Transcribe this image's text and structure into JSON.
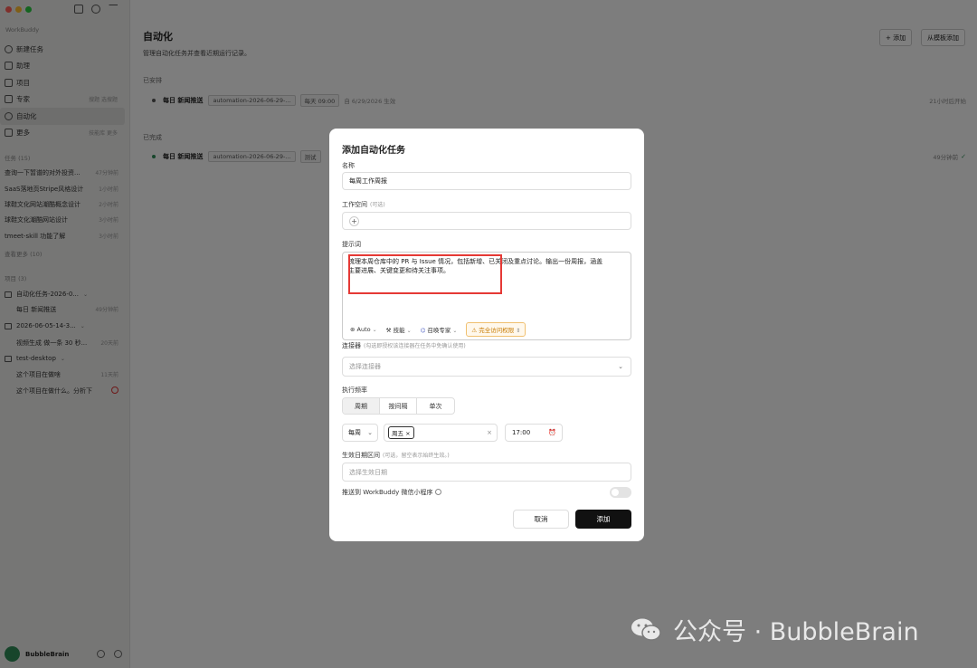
{
  "sidebar": {
    "workspace": "WorkBuddy",
    "nav": [
      {
        "label": "新建任务",
        "sub": ""
      },
      {
        "label": "助理",
        "sub": ""
      },
      {
        "label": "项目",
        "sub": ""
      },
      {
        "label": "专家",
        "sub": "搜题 选搜题"
      },
      {
        "label": "自动化",
        "sub": ""
      },
      {
        "label": "更多",
        "sub": "技能库 更多"
      }
    ],
    "tasks_title": "任务 (15)",
    "tasks": [
      {
        "label": "查询一下暂谱的对外投资...",
        "time": "47分钟前"
      },
      {
        "label": "SaaS落地页Stripe风格设计",
        "time": "1小时前"
      },
      {
        "label": "球鞋文化网站潮酷概念设计",
        "time": "2小时前"
      },
      {
        "label": "球鞋文化潮酷网站设计",
        "time": "3小时前"
      },
      {
        "label": "tmeet-skill 功能了解",
        "time": "3小时前"
      }
    ],
    "show_more": "查看更多 (10)",
    "projects_title": "项目 (3)",
    "projects": [
      {
        "label": "自动化任务-2026-0...",
        "children": [
          {
            "label": "每日 新闻推送",
            "time": "49分钟前"
          }
        ]
      },
      {
        "label": "2026-06-05-14-3...",
        "children": [
          {
            "label": "视频生成 做一条 30 秒...",
            "time": "20天前"
          }
        ]
      },
      {
        "label": "test-desktop",
        "children": [
          {
            "label": "这个项目在做啥",
            "time": "11天前"
          },
          {
            "label": "这个项目在做什么。分析下",
            "time": ""
          }
        ]
      }
    ],
    "user_name": "BubbleBrain"
  },
  "main": {
    "title": "自动化",
    "subtitle": "管理自动化任务并查看近期运行记录。",
    "add_button": "+ 添加",
    "template_button": "从模板添加",
    "scheduled_label": "已安排",
    "completed_label": "已完成",
    "scheduled": {
      "name": "每日 新闻推送",
      "chip1": "automation-2026-06-29-...",
      "chip2": "每天 09:00",
      "effective": "自 6/29/2026 生效",
      "right": "21小时后开始"
    },
    "completed": {
      "name": "每日 新闻推送",
      "chip1": "automation-2026-06-29-...",
      "chip2": "测试",
      "right": "49分钟前"
    }
  },
  "modal": {
    "title": "添加自动化任务",
    "name_label": "名称",
    "name_value": "每周工作周报",
    "workspace_label": "工作空间",
    "workspace_hint": "(可选)",
    "prompt_label": "提示词",
    "prompt_line1": "梳理本周仓库中的 PR 与 Issue 情况，包括新增、已关闭及重点讨论。输出一份周报，涵盖",
    "prompt_line2": "主要进展、关键变更和待关注事项。",
    "tools": {
      "auto": "Auto",
      "skills": "技能",
      "experts": "召唤专家",
      "access": "完全访问权限"
    },
    "connector_label": "连接器",
    "connector_hint": "(勾选即授权该连接器在任务中免确认使用)",
    "connector_placeholder": "选择连接器",
    "freq_label": "执行频率",
    "freq_tabs": [
      "周期",
      "按间隔",
      "单次"
    ],
    "period_value": "每周",
    "weekday_tag": "周五 ×",
    "clear": "×",
    "time_value": "17:00",
    "date_label": "生效日期区间",
    "date_hint": "(可选，留空表示始终生效。)",
    "date_placeholder": "选择生效日期",
    "push_label": "推送到 WorkBuddy 微信小程序",
    "cancel": "取消",
    "submit": "添加"
  },
  "watermark": "公众号 · BubbleBrain"
}
